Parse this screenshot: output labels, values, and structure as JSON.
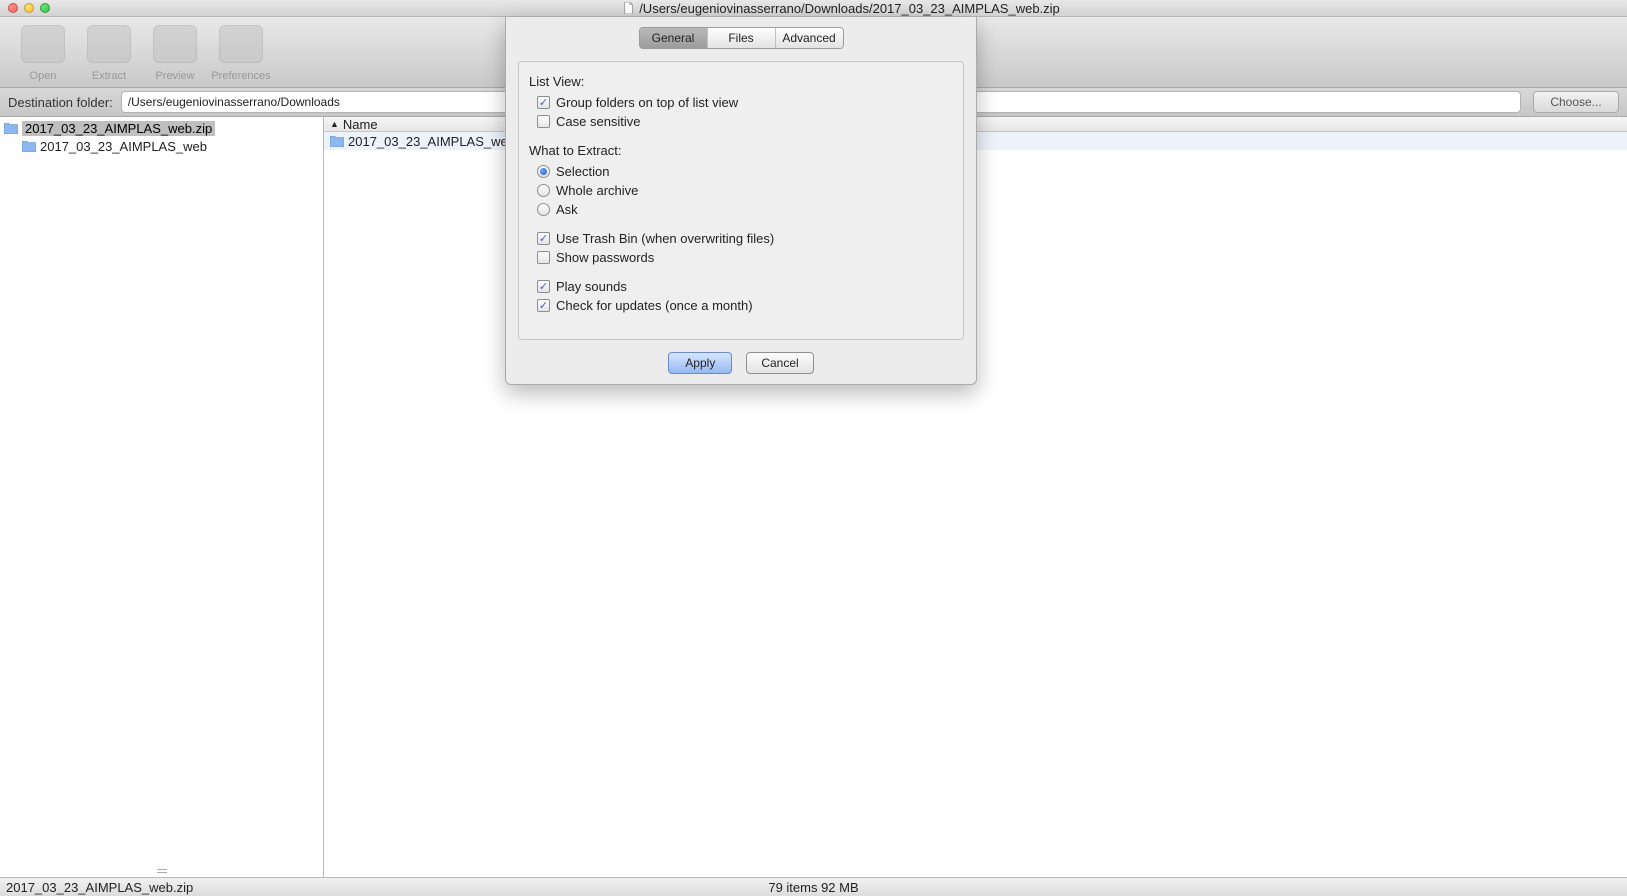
{
  "window": {
    "path_title": "/Users/eugeniovinasserrano/Downloads/2017_03_23_AIMPLAS_web.zip"
  },
  "toolbar": {
    "open_label": "Open",
    "extract_label": "Extract",
    "preview_label": "Preview",
    "preferences_label": "Preferences"
  },
  "destbar": {
    "label": "Destination folder:",
    "value": "/Users/eugeniovinasserrano/Downloads",
    "choose_label": "Choose..."
  },
  "sidebar": {
    "items": [
      {
        "label": "2017_03_23_AIMPLAS_web.zip",
        "selected": true,
        "indent": 0
      },
      {
        "label": "2017_03_23_AIMPLAS_web",
        "selected": false,
        "indent": 1
      }
    ]
  },
  "list": {
    "column_name": "Name",
    "rows": [
      {
        "label": "2017_03_23_AIMPLAS_web"
      }
    ]
  },
  "statusbar": {
    "left": "2017_03_23_AIMPLAS_web.zip",
    "center": "79 items  92 MB"
  },
  "modal": {
    "tabs": {
      "general": "General",
      "files": "Files",
      "advanced": "Advanced",
      "active": "general"
    },
    "list_view_label": "List View:",
    "cb_group_folders": {
      "label": "Group folders on top of list view",
      "checked": true
    },
    "cb_case_sensitive": {
      "label": "Case sensitive",
      "checked": false
    },
    "what_extract_label": "What to Extract:",
    "rb_selection": {
      "label": "Selection",
      "checked": true
    },
    "rb_whole_archive": {
      "label": "Whole archive",
      "checked": false
    },
    "rb_ask": {
      "label": "Ask",
      "checked": false
    },
    "cb_trash_bin": {
      "label": "Use Trash Bin (when overwriting files)",
      "checked": true
    },
    "cb_show_passwords": {
      "label": "Show passwords",
      "checked": false
    },
    "cb_play_sounds": {
      "label": "Play sounds",
      "checked": true
    },
    "cb_check_updates": {
      "label": "Check for updates (once a month)",
      "checked": true
    },
    "apply_label": "Apply",
    "cancel_label": "Cancel"
  }
}
